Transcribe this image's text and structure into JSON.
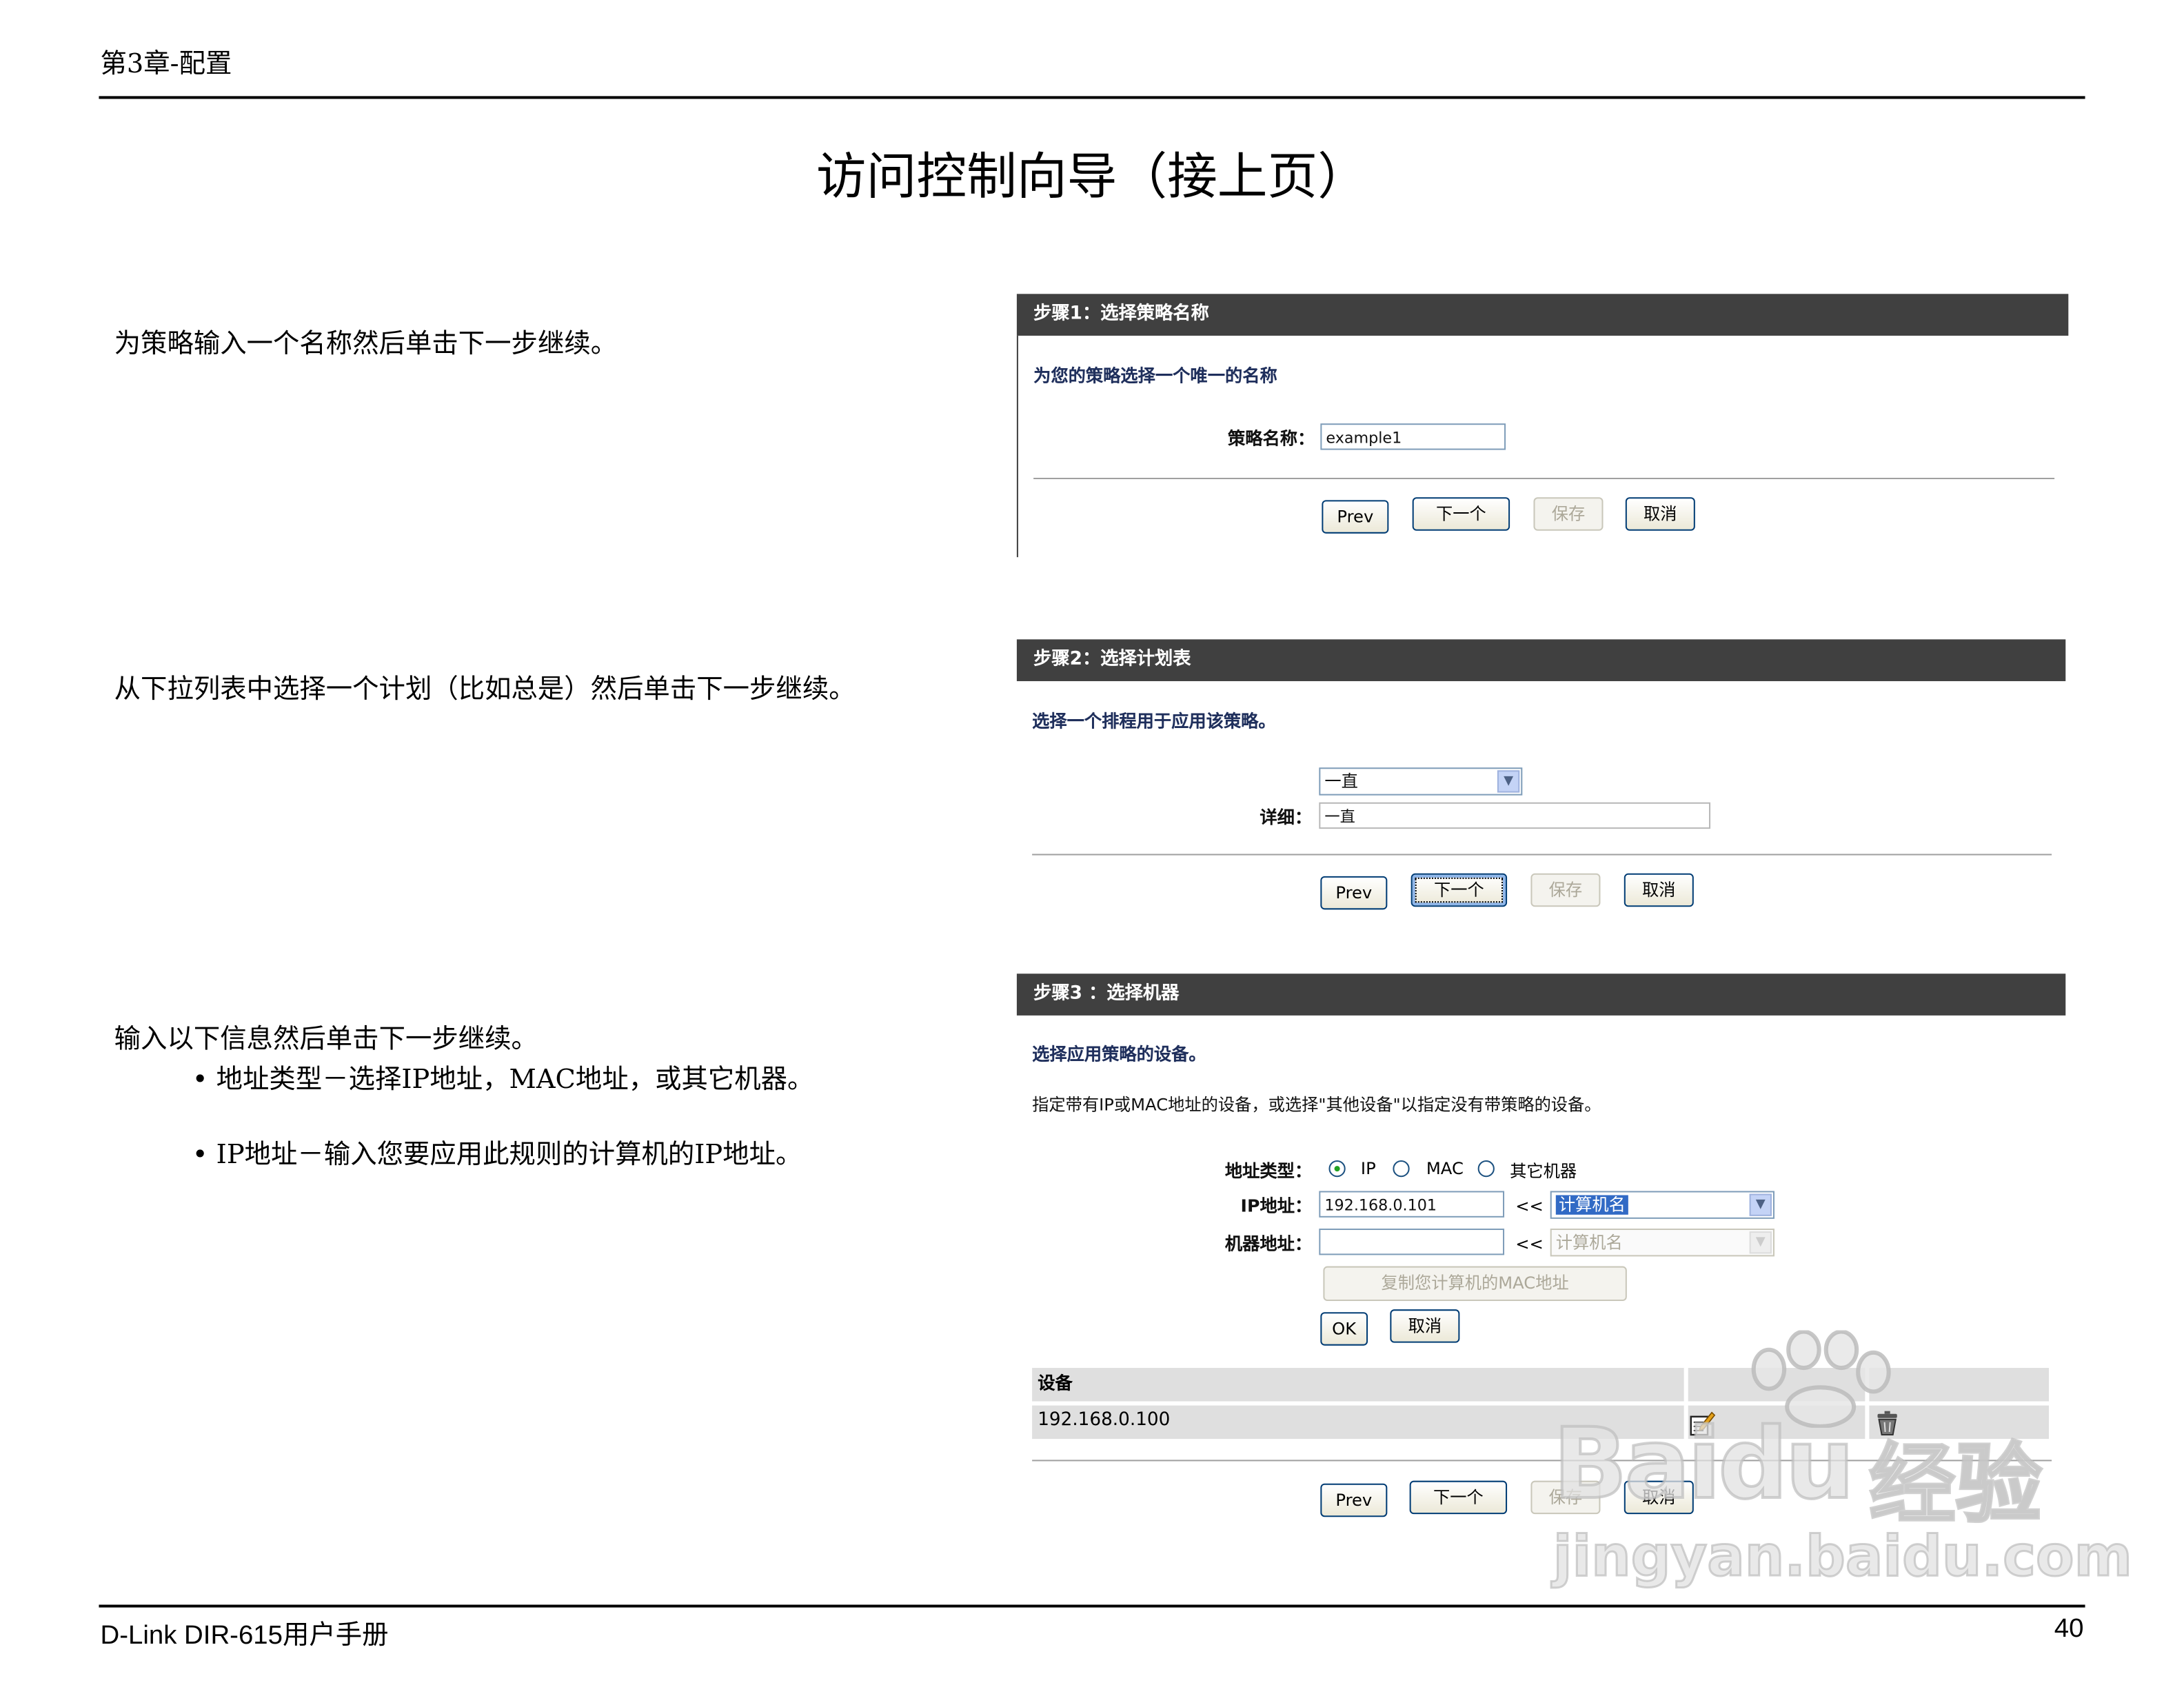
{
  "header": {
    "chapter": "第3章-配置"
  },
  "title": "访问控制向导（接上页）",
  "sections": [
    {
      "pre": "为策略输入一个名称然后单击",
      "bold": "下一步",
      "post": "继续。"
    },
    {
      "pre": "从下拉列表中选择一个计划（比如总是）然后单击",
      "bold": "下一步",
      "post": "继续。"
    },
    {
      "pre": "输入以下信息然后单击",
      "bold": "下一步",
      "post": "继续。",
      "bullets": [
        "• 地址类型－选择IP地址，MAC地址，或其它机器。",
        "• IP地址－输入您要应用此规则的计算机的IP地址。"
      ]
    }
  ],
  "step1": {
    "header": "步骤1：选择策略名称",
    "prompt": "为您的策略选择一个唯一的名称",
    "name_label": "策略名称：",
    "name_value": "example1",
    "buttons": {
      "prev": "Prev",
      "next": "下一个",
      "save": "保存",
      "cancel": "取消"
    }
  },
  "step2": {
    "header": "步骤2：选择计划表",
    "prompt": "选择一个排程用于应用该策略。",
    "schedule_value": "一直",
    "details_label": "详细：",
    "details_value": "一直",
    "buttons": {
      "prev": "Prev",
      "next": "下一个",
      "save": "保存",
      "cancel": "取消"
    }
  },
  "step3": {
    "header": "步骤3 ：选择机器",
    "prompt": "选择应用策略的设备。",
    "instruction": "指定带有IP或MAC地址的设备，或选择\"其他设备\"以指定没有带策略的设备。",
    "addr_type_label": "地址类型：",
    "radio_ip": "IP",
    "radio_mac": "MAC",
    "radio_other": "其它机器",
    "ip_label": "IP地址：",
    "ip_value": "192.168.0.101",
    "arrows": "<<",
    "computer_name": "计算机名",
    "machine_label": "机器地址：",
    "machine_value": "",
    "copy_mac_button": "复制您计算机的MAC地址",
    "ok_button": "OK",
    "cancel_button": "取消",
    "table": {
      "header": "设备",
      "rows": [
        {
          "device": "192.168.0.100"
        }
      ]
    },
    "buttons": {
      "prev": "Prev",
      "next": "下一个",
      "save": "保存",
      "cancel": "取消"
    }
  },
  "watermark": {
    "brand": "Bai",
    "brand2": "du",
    "cn": "经验",
    "url": "jingyan.baidu.com"
  },
  "footer": {
    "manual": "D-Link DIR-615用户手册",
    "page": "40"
  }
}
